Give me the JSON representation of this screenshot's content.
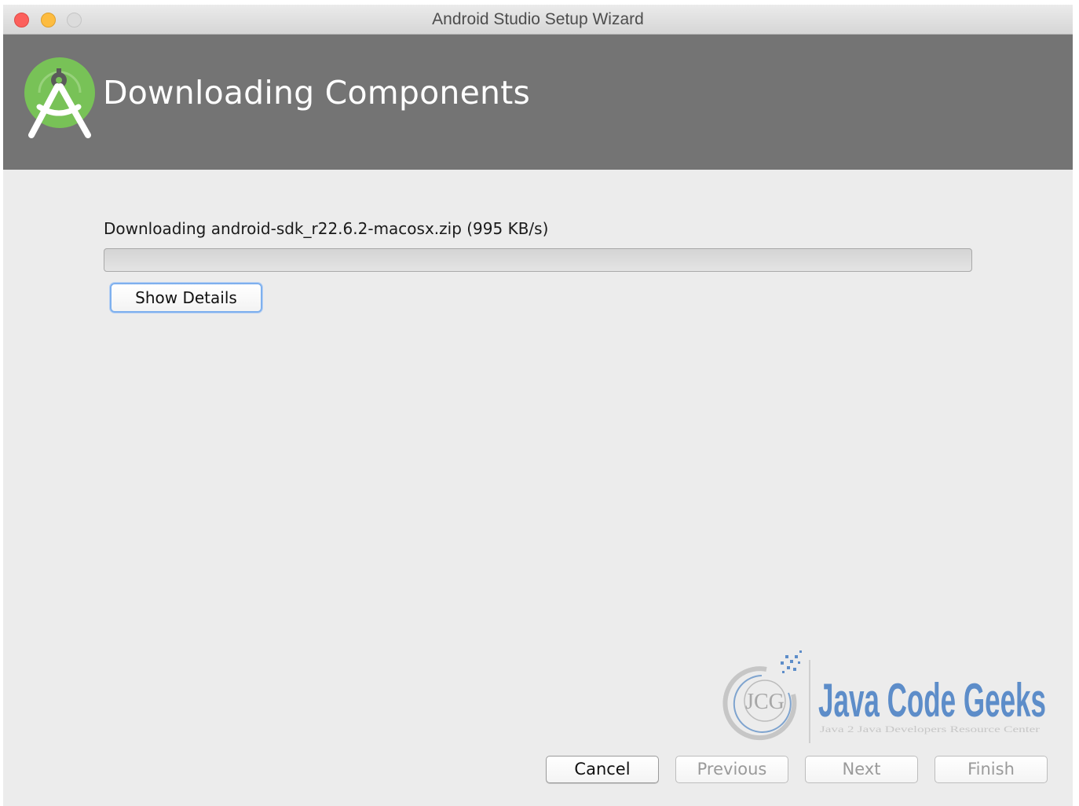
{
  "window": {
    "title": "Android Studio Setup Wizard"
  },
  "header": {
    "title": "Downloading Components",
    "logo_icon": "android-studio-logo-icon",
    "background_color": "#747474",
    "logo_green": "#78c257"
  },
  "download": {
    "status_text": "Downloading android-sdk_r22.6.2-macosx.zip (995 KB/s)",
    "progress_percent": 0,
    "show_details_label": "Show Details"
  },
  "watermark": {
    "badge_text": "JCG",
    "brand_name": "Java Code Geeks",
    "tagline": "Java 2 Java Developers Resource Center",
    "brand_color_blue": "#5d8dc9",
    "brand_color_green": "#9fc13f"
  },
  "footer": {
    "cancel_label": "Cancel",
    "previous_label": "Previous",
    "next_label": "Next",
    "finish_label": "Finish"
  }
}
